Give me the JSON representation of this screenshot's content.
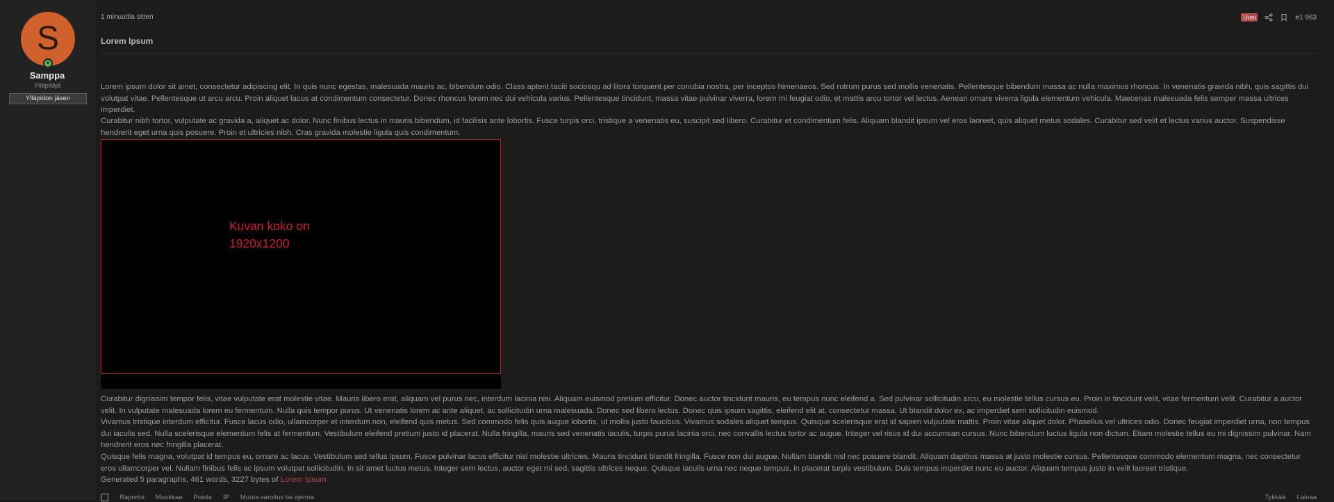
{
  "user": {
    "avatar_letter": "S",
    "avatar_color": "#d0612c",
    "name": "Samppa",
    "title": "Ylläpitäjä",
    "banner": "Ylläpidon jäsen",
    "online": true
  },
  "post": {
    "time": "1 minuuttia sitten",
    "badge_new": "Uusi",
    "post_number": "#1 963",
    "title": "Lorem Ipsum",
    "paragraphs_top": [
      "Lorem ipsum dolor sit amet, consectetur adipiscing elit. In quis nunc egestas, malesuada mauris ac, bibendum odio. Class aptent taciti sociosqu ad litora torquent per conubia nostra, per inceptos himenaeos. Sed rutrum purus sed mollis venenatis. Pellentesque bibendum massa ac nulla maximus rhoncus. In venenatis gravida nibh, quis sagittis dui volutpat vitae. Pellentesque ut arcu arcu. Proin aliquet lacus at condimentum consectetur. Donec rhoncus lorem nec dui vehicula varius. Pellentesque tincidunt, massa vitae pulvinar viverra, lorem mi feugiat odio, et mattis arcu tortor vel lectus. Aenean ornare viverra ligula elementum vehicula. Maecenas malesuada felis semper massa ultrices imperdiet.",
      "Curabitur nibh tortor, vulputate ac gravida a, aliquet ac dolor. Nunc finibus lectus in mauris bibendum, id facilisis ante lobortis. Fusce turpis orci, tristique a venenatis eu, suscipit sed libero. Curabitur et condimentum felis. Aliquam blandit ipsum vel eros laoreet, quis aliquet metus sodales. Curabitur sed velit et lectus varius auctor. Suspendisse hendrerit eget urna quis posuere. Proin et ultricies nibh. Cras gravida molestie ligula quis condimentum."
    ],
    "image_text_line1": "Kuvan koko on",
    "image_text_line2": "1920x1200",
    "paragraphs_bottom": [
      "Curabitur dignissim tempor felis, vitae vulputate erat molestie vitae. Mauris libero erat, aliquam vel purus nec, interdum lacinia nisi. Aliquam euismod pretium efficitur. Donec auctor tincidunt mauris, eu tempus nunc eleifend a. Sed pulvinar sollicitudin arcu, eu molestie tellus cursus eu. Proin in tincidunt velit, vitae fermentum velit. Curabitur a auctor velit. In vulputate malesuada lorem eu fermentum. Nulla quis tempor purus. Ut venenatis lorem ac ante aliquet, ac sollicitudin urna malesuada. Donec sed libero lectus. Donec quis ipsum sagittis, eleifend elit at, consectetur massa. Ut blandit dolor ex, ac imperdiet sem sollicitudin euismod.",
      "Vivamus tristique interdum efficitur. Fusce lacus odio, ullamcorper et interdum non, eleifend quis metus. Sed commodo felis quis augue lobortis, ut mollis justo faucibus. Vivamus sodales aliquet tempus. Quisque scelerisque erat id sapien vulputate mattis. Proin vitae aliquet dolor. Phasellus vel ultrices odio. Donec feugiat imperdiet urna, non tempus dui iaculis sed. Nulla scelerisque elementum felis at fermentum. Vestibulum eleifend pretium justo id placerat. Nulla fringilla, mauris sed venenatis iaculis, turpis purus lacinia orci, nec convallis lectus tortor ac augue. Integer vel risus id dui accumsan cursus. Nunc bibendum luctus ligula non dictum. Etiam molestie tellus eu mi dignissim pulvinar. Nam hendrerit eros nec fringilla placerat.",
      "Quisque felis magna, volutpat id tempus eu, ornare ac lacus. Vestibulum sed tellus ipsum. Fusce pulvinar lacus efficitur nisl molestie ultricies. Mauris tincidunt blandit fringilla. Fusce non dui augue. Nullam blandit nisl nec posuere blandit. Aliquam dapibus massa at justo molestie cursus. Pellentesque commodo elementum magna, nec consectetur eros ullamcorper vel. Nullam finibus felis ac ipsum volutpat sollicitudin. In sit amet luctus metus. Integer sem lectus, auctor eget mi sed, sagittis ultrices neque. Quisque iaculis urna nec neque tempus, in placerat turpis vestibulum. Duis tempus imperdiet nunc eu auctor. Aliquam tempus justo in velit laoreet tristique."
    ],
    "generated_prefix": "Generated 5 paragraphs, 461 words, 3227 bytes of ",
    "generated_link": "Lorem Ipsum",
    "link_color": "#b24a4a"
  },
  "actions": {
    "report": "Raportoi",
    "edit": "Muokkaa",
    "delete": "Poista",
    "ip": "IP",
    "warn": "Muuta varoitus tai ojenna",
    "like": "Tykkää",
    "reply": "Lainaa"
  },
  "icons": {
    "share": "share-icon",
    "bookmark": "bookmark-icon"
  }
}
